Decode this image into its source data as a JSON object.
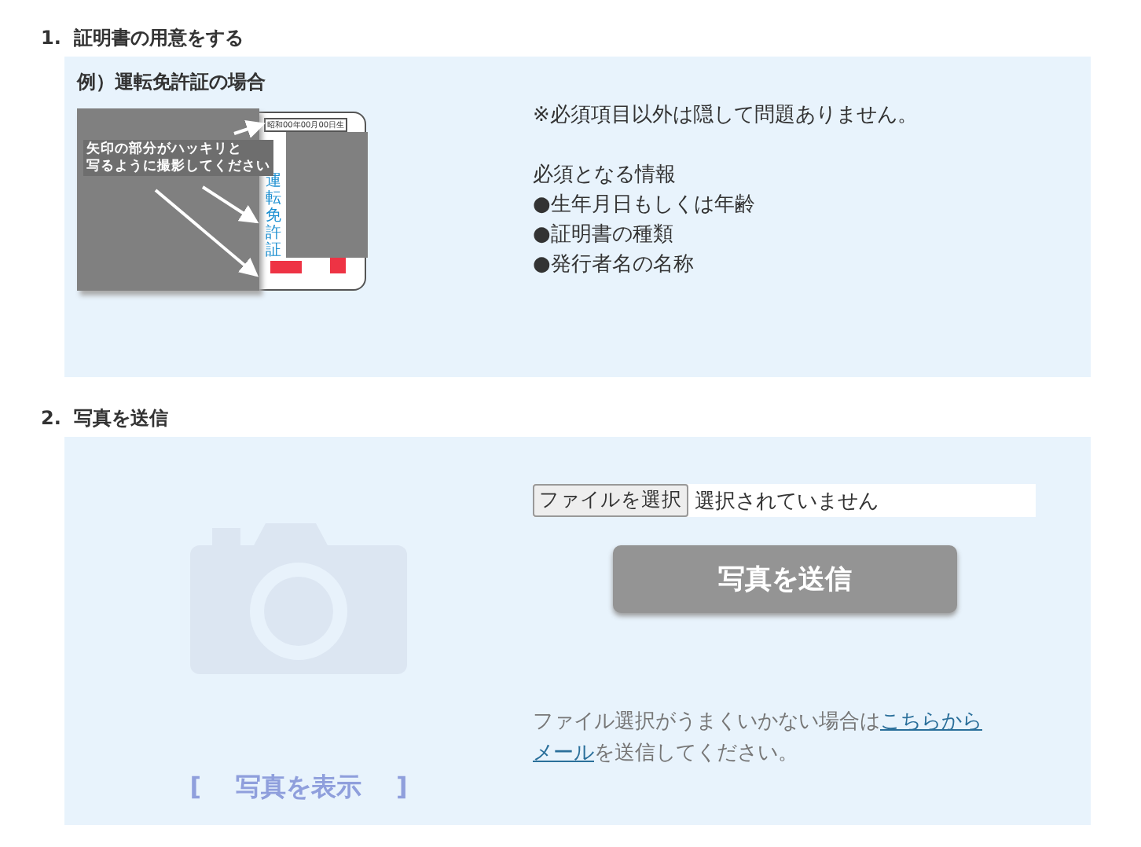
{
  "sections": [
    {
      "number": "1.",
      "title": "証明書の用意をする"
    },
    {
      "number": "2.",
      "title": "写真を送信"
    }
  ],
  "example": {
    "title": "例）運転免許証の場合",
    "caption_lines": [
      "矢印の部分がハッキリと",
      "写るように撮影してください"
    ],
    "card_date": "昭和00年00月00日生",
    "card_label": "運転免許証"
  },
  "notes": {
    "hint": "※必須項目以外は隠して問題ありません。",
    "required_heading": "必須となる情報",
    "required_items": [
      {
        "bullet": "●",
        "text": "生年月日もしくは年齢"
      },
      {
        "bullet": "●",
        "text": "証明書の種類"
      },
      {
        "bullet": "●",
        "text": "発行者名の名称"
      }
    ]
  },
  "upload": {
    "file_button": "ファイルを選択",
    "file_status": "選択されていません",
    "submit": "写真を送信",
    "preview_open": "[",
    "preview_label": "写真を表示",
    "preview_close": "]",
    "help_before": "ファイル選択がうまくいかない場合は",
    "help_link_1": "こちらから",
    "help_link_2": "メール",
    "help_after": "を送信してください。"
  }
}
